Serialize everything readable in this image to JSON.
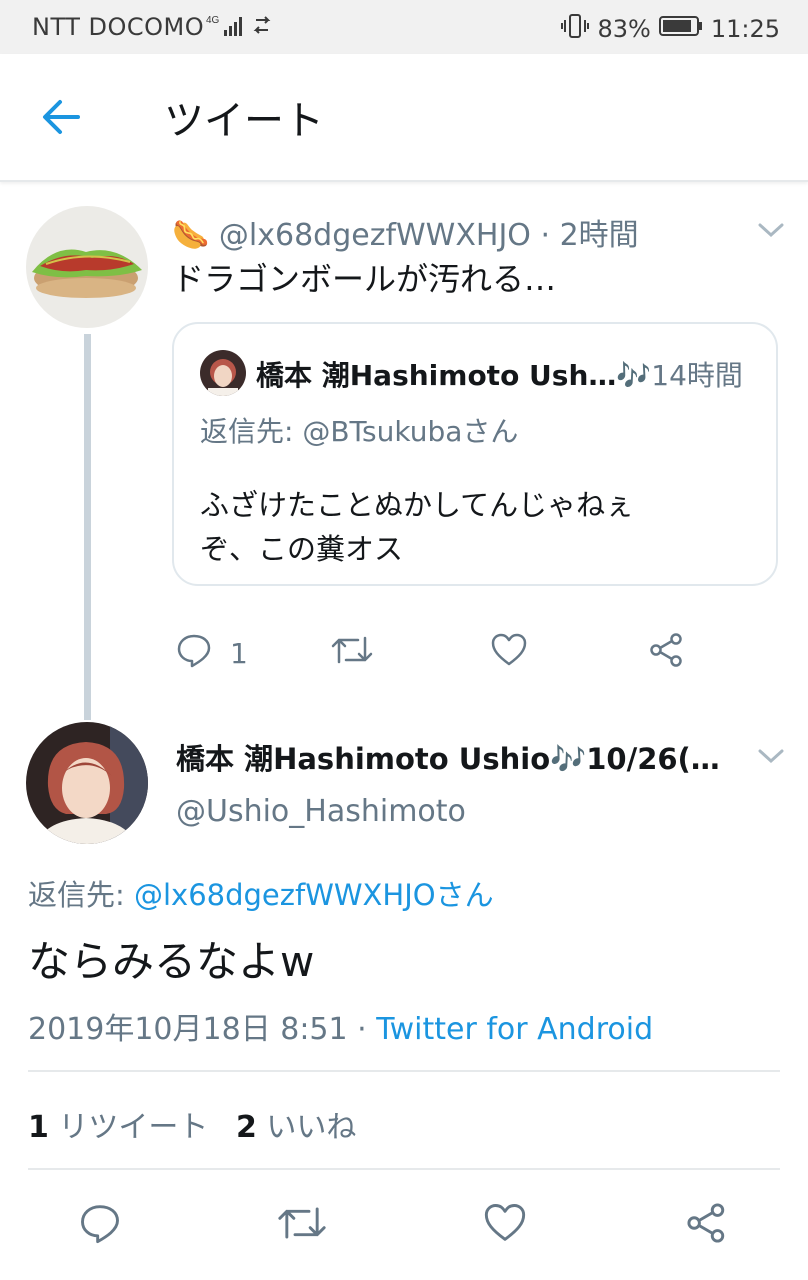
{
  "status_bar": {
    "carrier": "NTT DOCOMO",
    "network": "4G",
    "battery": "83%",
    "time": "11:25"
  },
  "header": {
    "title": "ツイート"
  },
  "tweet1": {
    "emoji": "🌭",
    "handle": "@lx68dgezfWWXHJO",
    "time": "2時間",
    "text": "ドラゴンボールが汚れる…",
    "quote": {
      "name": "橋本 潮Hashimoto Ush…",
      "name_emoji": "🎶",
      "time": "14時間",
      "reply_prefix": "返信先:",
      "reply_to": "@BTsukubaさん",
      "text_line1": "ふざけたことぬかしてんじゃねぇ",
      "text_line2": "ぞ、この糞オス"
    },
    "reply_count": "1"
  },
  "tweet2": {
    "name": "橋本 潮Hashimoto Ushio",
    "name_emoji": "🎶",
    "date_trunc": "10/26(…",
    "handle": "@Ushio_Hashimoto",
    "reply_prefix": "返信先:",
    "reply_to": "@lx68dgezfWWXHJOさん",
    "text": "ならみるなよw",
    "timestamp": "2019年10月18日 8:51",
    "source": "Twitter for Android",
    "retweet_count": "1",
    "retweet_label": "リツイート",
    "like_count": "2",
    "like_label": "いいね"
  },
  "colors": {
    "accent": "#1b95e0",
    "muted": "#657786",
    "border": "#e1e8ed"
  },
  "icons": [
    "back-arrow-icon",
    "reply-icon",
    "retweet-icon",
    "like-icon",
    "share-icon",
    "chevron-down-icon"
  ]
}
